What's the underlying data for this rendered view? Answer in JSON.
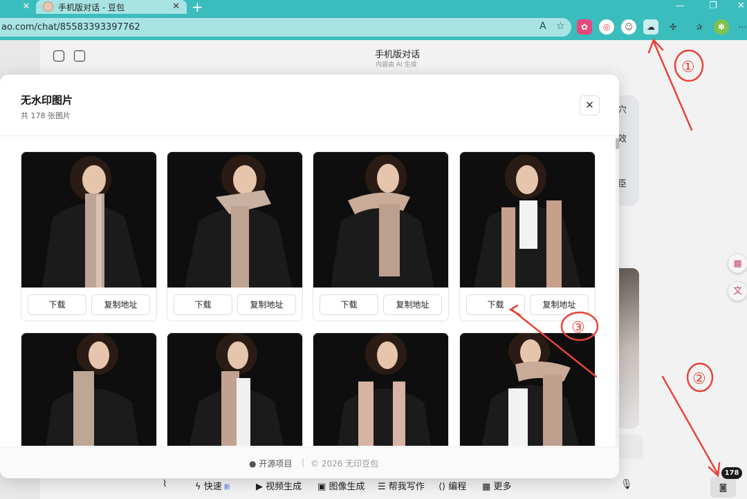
{
  "browser": {
    "tab_title": "手机版对话 - 豆包",
    "url": "ao.com/chat/85583393397762"
  },
  "chat": {
    "title": "手机版对话",
    "subtitle": "内容由 AI 生成",
    "bubble_fragments": [
      "穴",
      "效",
      "臣"
    ]
  },
  "modal": {
    "title": "无水印图片",
    "subtitle": "共 178 张图片",
    "download_label": "下载",
    "copy_label": "复制地址",
    "footer_github": "开源项目",
    "footer_copyright": "© 2026 无印豆包"
  },
  "bottom_bar": {
    "items": [
      "快速",
      "视频生成",
      "图像生成",
      "帮我写作",
      "编程",
      "更多"
    ],
    "new_badge": "新"
  },
  "counter_badge": "178",
  "annotations": [
    "①",
    "②",
    "③"
  ],
  "colors": {
    "browser_chrome": "#3bbcbd",
    "address_box": "#a9e4e4",
    "annotation_red": "#e8433a"
  }
}
